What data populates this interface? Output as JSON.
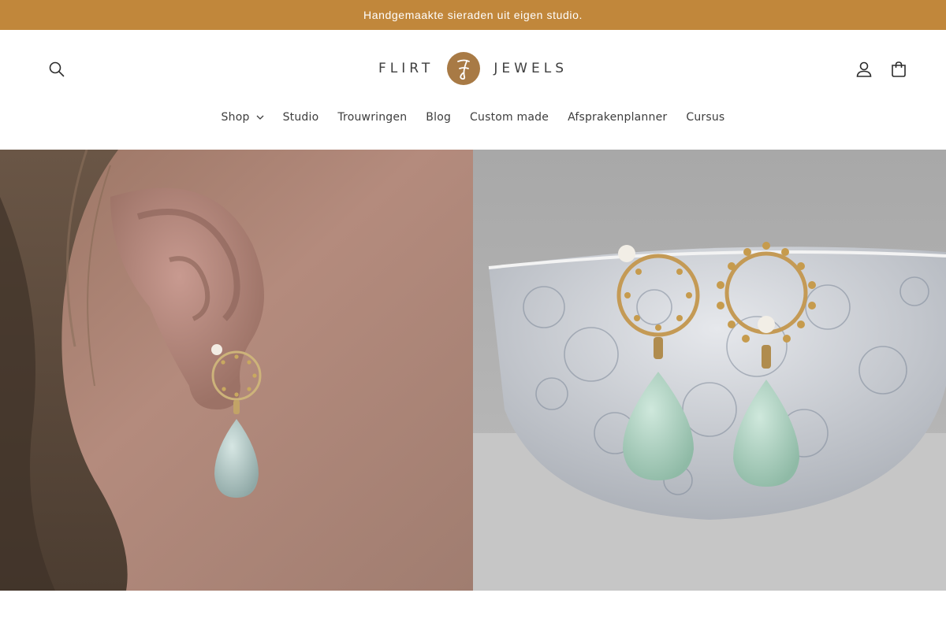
{
  "announcement": {
    "text": "Handgemaakte sieraden uit eigen studio."
  },
  "header": {
    "logo": {
      "left_word": "FLIRT",
      "right_word": "JEWELS",
      "badge_icon": "fj-monogram-icon"
    },
    "icons": {
      "search": "search-icon",
      "account": "user-icon",
      "cart": "cart-icon"
    }
  },
  "nav": {
    "items": [
      {
        "label": "Shop",
        "has_dropdown": true
      },
      {
        "label": "Studio"
      },
      {
        "label": "Trouwringen"
      },
      {
        "label": "Blog"
      },
      {
        "label": "Custom made"
      },
      {
        "label": "Afsprakenplanner"
      },
      {
        "label": "Cursus"
      }
    ]
  },
  "colors": {
    "accent": "#c1873b",
    "logo_badge": "#a87a45",
    "text": "#3d3d3d"
  }
}
